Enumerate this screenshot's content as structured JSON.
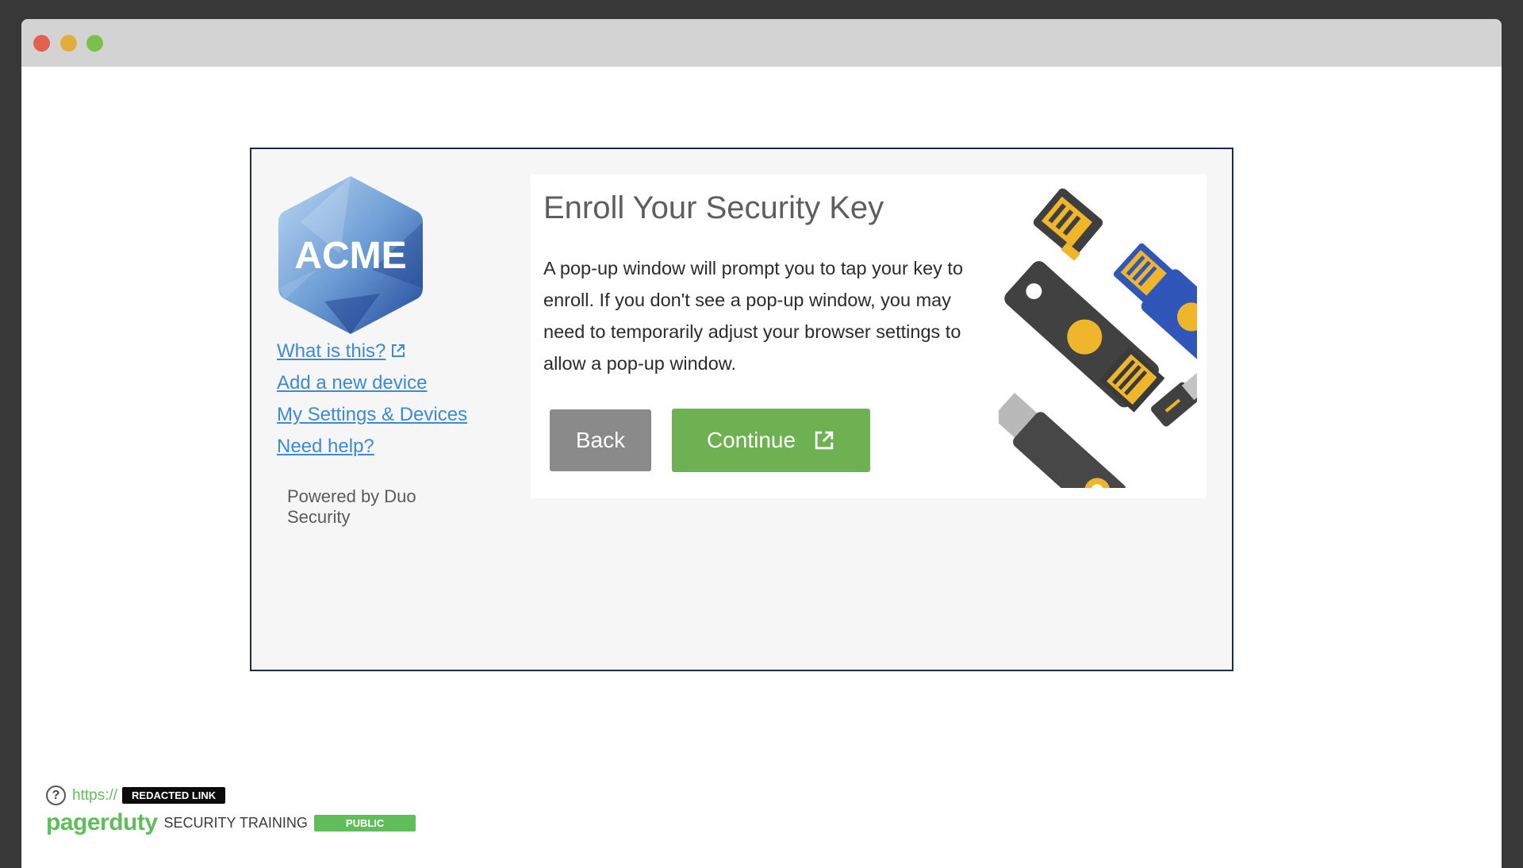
{
  "sidebar": {
    "logo_text": "ACME",
    "links": {
      "what_is_this": "What is this?",
      "add_device": "Add a new device",
      "settings": "My Settings & Devices",
      "need_help": "Need help?"
    },
    "powered_by": "Powered by Duo Security"
  },
  "panel": {
    "title": "Enroll Your Security Key",
    "body": "A pop-up window will prompt you to tap your key to enroll. If you don't see a pop-up window, you may need to temporarily adjust your browser settings to allow a pop-up window.",
    "back_label": "Back",
    "continue_label": "Continue"
  },
  "footer": {
    "url_prefix": "https://",
    "redacted_label": "REDACTED LINK",
    "brand": "pagerduty",
    "training_label": "SECURITY TRAINING",
    "public_label": "PUBLIC",
    "help_glyph": "?"
  },
  "colors": {
    "link": "#3a8ad6",
    "continue": "#6db153",
    "back": "#8a8a8a",
    "brand_green": "#5fbd5a",
    "frame_border": "#1e2c48"
  },
  "icons": [
    "external-link-icon",
    "acme-logo",
    "security-keys-illustration",
    "help-icon"
  ]
}
